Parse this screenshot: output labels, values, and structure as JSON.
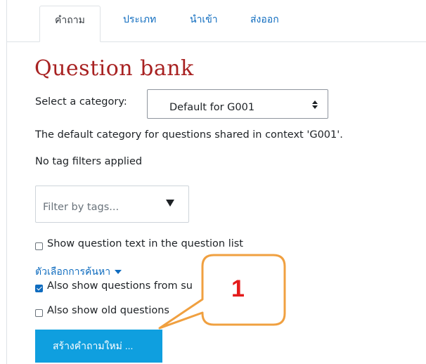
{
  "tabs": [
    {
      "label": "คำถาม",
      "active": true
    },
    {
      "label": "ประเภท",
      "active": false
    },
    {
      "label": "นำเข้า",
      "active": false
    },
    {
      "label": "ส่งออก",
      "active": false
    }
  ],
  "page_title": "Question bank",
  "category": {
    "label": "Select a category:",
    "selected": "Default for G001"
  },
  "category_description": "The default category for questions shared in context 'G001'.",
  "tag_status": "No tag filters applied",
  "tag_filter": {
    "placeholder": "Filter by tags..."
  },
  "options": {
    "show_text": {
      "label": "Show question text in the question list",
      "checked": false
    },
    "search_options_link": "ตัวเลือกการค้นหา",
    "subcategories": {
      "label": "Also show questions from su",
      "checked": true
    },
    "old_questions": {
      "label": "Also show old questions",
      "checked": false
    }
  },
  "create_button": "สร้างคำถามใหม่ ...",
  "callout": {
    "number": "1"
  },
  "colors": {
    "heading": "#a82222",
    "link": "#0f6cbf",
    "button": "#0f9fdf",
    "callout_border": "#f0a040",
    "callout_number": "#e41b1b"
  }
}
